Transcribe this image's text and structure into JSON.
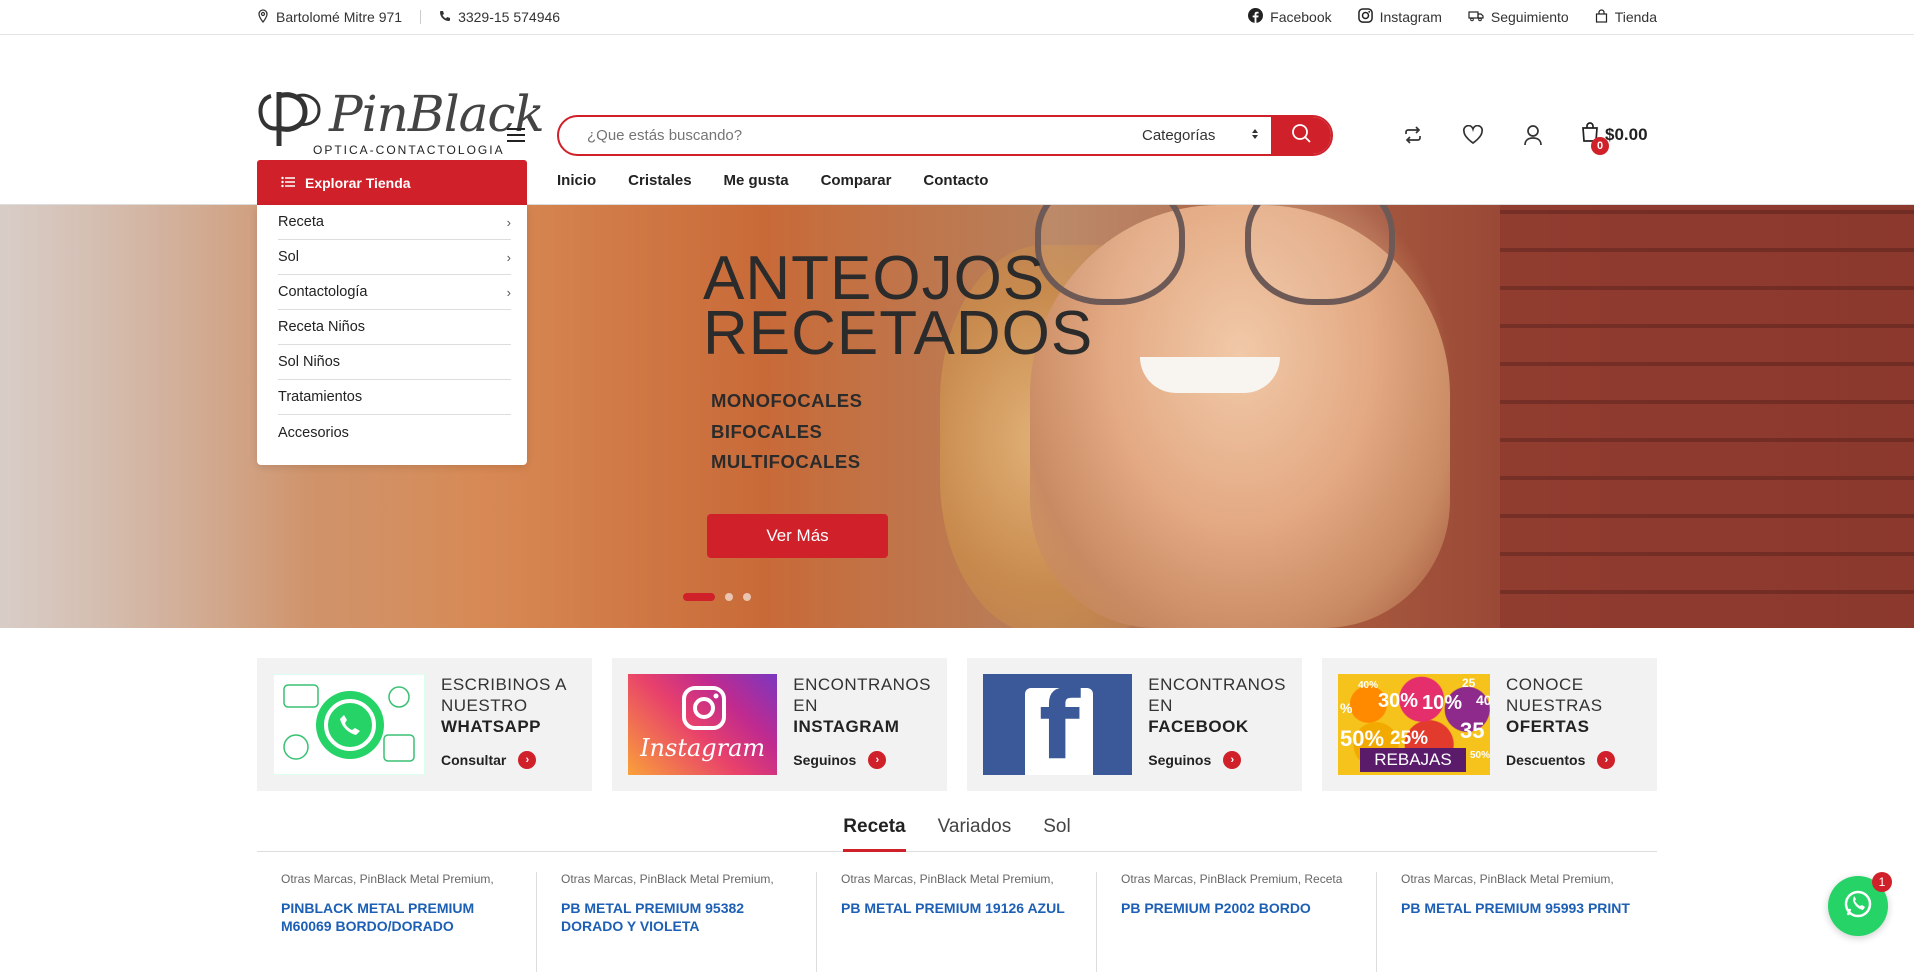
{
  "topbar": {
    "address": "Bartolomé Mitre 971",
    "phone": "3329-15 574946",
    "links": [
      "Facebook",
      "Instagram",
      "Seguimiento",
      "Tienda"
    ]
  },
  "logo": {
    "name": "PinBlack",
    "subtitle": "OPTICA-CONTACTOLOGIA"
  },
  "search": {
    "placeholder": "¿Que estás buscando?",
    "category": "Categorías"
  },
  "cart": {
    "amount": "$0.00",
    "count": "0"
  },
  "explore": {
    "label": "Explorar Tienda"
  },
  "nav": [
    "Inicio",
    "Cristales",
    "Me gusta",
    "Comparar",
    "Contacto"
  ],
  "menu": [
    {
      "label": "Receta",
      "arrow": true
    },
    {
      "label": "Sol",
      "arrow": true
    },
    {
      "label": "Contactología",
      "arrow": true
    },
    {
      "label": "Receta Niños",
      "arrow": false
    },
    {
      "label": "Sol Niños",
      "arrow": false
    },
    {
      "label": "Tratamientos",
      "arrow": false
    },
    {
      "label": "Accesorios",
      "arrow": false
    }
  ],
  "hero": {
    "title_1": "ANTEOJOS",
    "title_2": "RECETADOS",
    "list": [
      "MONOFOCALES",
      "BIFOCALES",
      "MULTIFOCALES"
    ],
    "button": "Ver Más",
    "slides": 3,
    "active_slide": 1
  },
  "promos": [
    {
      "l1a": "ESCRIBINOS A",
      "l1b": "NUESTRO",
      "l2": "WHATSAPP",
      "cta": "Consultar",
      "img_text": ""
    },
    {
      "l1a": "ENCONTRANOS",
      "l1b": "EN",
      "l2": "INSTAGRAM",
      "cta": "Seguinos",
      "img_text": "Instagram"
    },
    {
      "l1a": "ENCONTRANOS",
      "l1b": "EN",
      "l2": "FACEBOOK",
      "cta": "Seguinos",
      "img_text": "f"
    },
    {
      "l1a": "CONOCE",
      "l1b": "NUESTRAS",
      "l2": "OFERTAS",
      "cta": "Descuentos",
      "img_text": "REBAJAS"
    }
  ],
  "sale_img": [
    "40%",
    "30%",
    "10%",
    "25",
    "40",
    "%",
    "50%",
    "25%",
    "35",
    "50%"
  ],
  "tabs": [
    "Receta",
    "Variados",
    "Sol"
  ],
  "products": [
    {
      "cats": "Otras Marcas, PinBlack Metal Premium,",
      "name": "PINBLACK METAL PREMIUM M60069 BORDO/DORADO"
    },
    {
      "cats": "Otras Marcas, PinBlack Metal Premium,",
      "name": "PB METAL PREMIUM 95382 DORADO Y VIOLETA"
    },
    {
      "cats": "Otras Marcas, PinBlack Metal Premium,",
      "name": "PB METAL PREMIUM 19126 AZUL"
    },
    {
      "cats": "Otras Marcas, PinBlack Premium, Receta",
      "name": "PB PREMIUM P2002 BORDO"
    },
    {
      "cats": "Otras Marcas, PinBlack Metal Premium,",
      "name": "PB METAL PREMIUM 95993 PRINT"
    }
  ],
  "whatsapp_float": {
    "count": "1"
  },
  "colors": {
    "accent": "#d0202a",
    "link": "#1c5fb5",
    "promo_bg": "#f2f2f2"
  }
}
